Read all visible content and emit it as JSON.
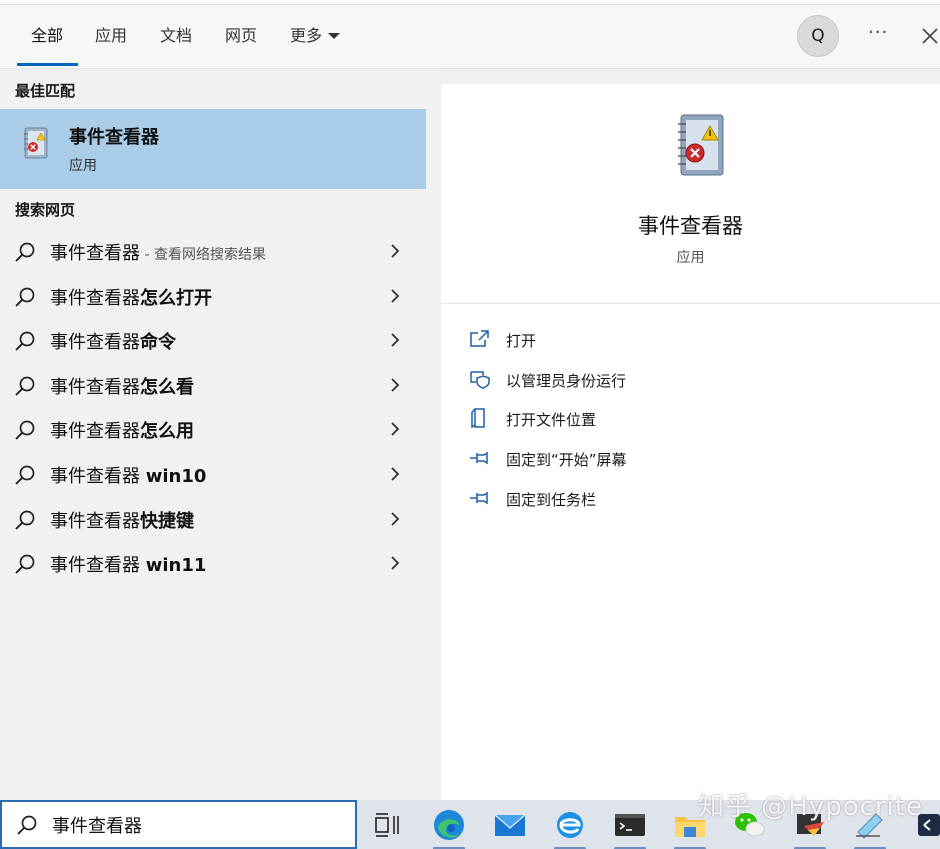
{
  "tabs": [
    {
      "label": "全部",
      "active": true
    },
    {
      "label": "应用"
    },
    {
      "label": "文档"
    },
    {
      "label": "网页"
    },
    {
      "label": "更多"
    }
  ],
  "header": {
    "avatar_letter": "Q",
    "more_label": "···",
    "close_icon": "close-icon"
  },
  "best_match": {
    "section_title": "最佳匹配",
    "title": "事件查看器",
    "subtitle": "应用",
    "icon": "event-viewer-icon"
  },
  "web_search": {
    "section_title": "搜索网页",
    "items": [
      {
        "prefix": "事件查看器",
        "bold": "",
        "hint": " - 查看网络搜索结果"
      },
      {
        "prefix": "事件查看器",
        "bold": "怎么打开",
        "hint": ""
      },
      {
        "prefix": "事件查看器",
        "bold": "命令",
        "hint": ""
      },
      {
        "prefix": "事件查看器",
        "bold": "怎么看",
        "hint": ""
      },
      {
        "prefix": "事件查看器",
        "bold": "怎么用",
        "hint": ""
      },
      {
        "prefix": "事件查看器 ",
        "bold": "win10",
        "hint": ""
      },
      {
        "prefix": "事件查看器",
        "bold": "快捷键",
        "hint": ""
      },
      {
        "prefix": "事件查看器 ",
        "bold": "win11",
        "hint": ""
      }
    ]
  },
  "detail": {
    "title": "事件查看器",
    "subtitle": "应用",
    "actions": [
      {
        "label": "打开",
        "icon": "open-icon"
      },
      {
        "label": "以管理员身份运行",
        "icon": "shield-icon"
      },
      {
        "label": "打开文件位置",
        "icon": "file-location-icon"
      },
      {
        "label": "固定到“开始”屏幕",
        "icon": "pin-icon"
      },
      {
        "label": "固定到任务栏",
        "icon": "pin-icon"
      }
    ]
  },
  "taskbar": {
    "search_value": "事件查看器",
    "apps": [
      "task-view-icon",
      "edge-icon",
      "mail-icon",
      "ie-icon",
      "terminal-icon",
      "file-explorer-icon",
      "wechat-icon",
      "app-icon",
      "notepad-icon",
      "vscode-icon"
    ]
  },
  "watermark": "知乎 @Hypocrite",
  "colors": {
    "accent": "#0067c0",
    "selected_bg": "#a9cde8",
    "left_bg": "#f0f1f3",
    "right_bg": "#ffffff"
  }
}
